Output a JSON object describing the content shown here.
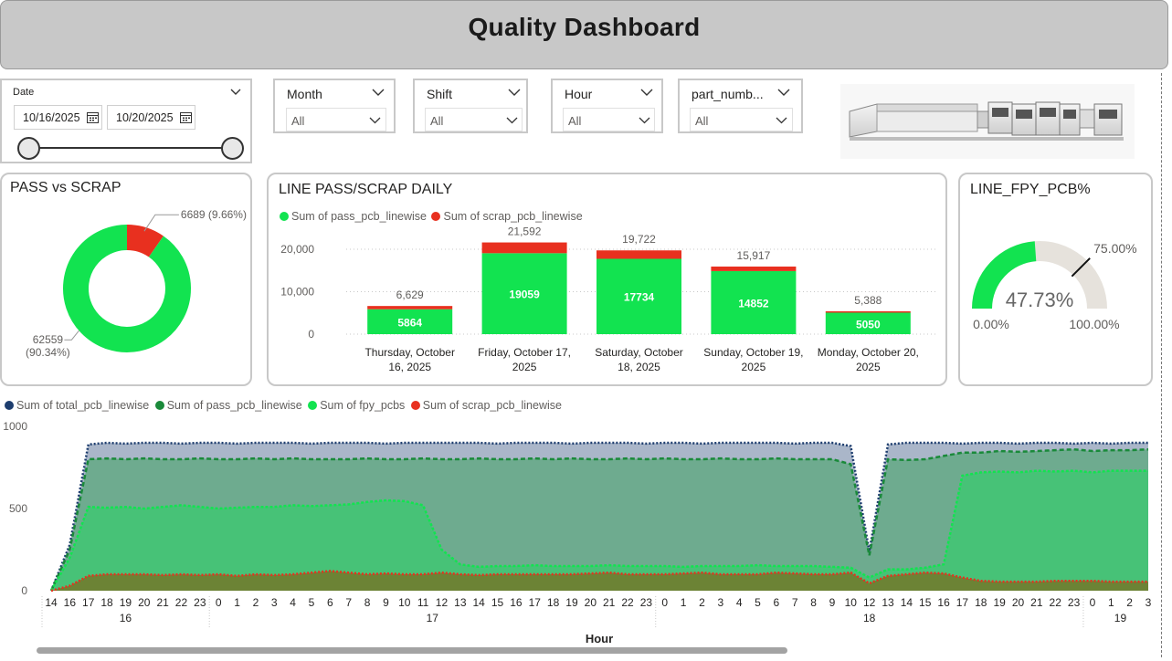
{
  "header": {
    "title": "Quality Dashboard"
  },
  "slicers": {
    "date": {
      "label": "Date",
      "start": "10/16/2025",
      "end": "10/20/2025"
    },
    "month": {
      "label": "Month",
      "value": "All"
    },
    "shift": {
      "label": "Shift",
      "value": "All"
    },
    "hour": {
      "label": "Hour",
      "value": "All"
    },
    "part": {
      "label": "part_numb...",
      "value": "All"
    }
  },
  "colors": {
    "pass": "#12e350",
    "scrap": "#e8301f",
    "total": "#1d3d6e",
    "pass_dark": "#1a8a3a",
    "gauge_track": "#e6e2dc"
  },
  "icons": {
    "calendar": "calendar-icon",
    "chevron": "chevron-down-icon"
  },
  "chart_data": [
    {
      "type": "pie",
      "title": "PASS vs SCRAP",
      "slices": [
        {
          "name": "pass",
          "value": 62559,
          "label_value": "62559",
          "label_pct": "(90.34%)"
        },
        {
          "name": "scrap",
          "value": 6689,
          "label": "6689 (9.66%)"
        }
      ]
    },
    {
      "type": "bar",
      "title": "LINE PASS/SCRAP DAILY",
      "legend": [
        "Sum of pass_pcb_linewise",
        "Sum of scrap_pcb_linewise"
      ],
      "categories": [
        [
          "Thursday, October",
          "16, 2025"
        ],
        [
          "Friday, October 17,",
          "2025"
        ],
        [
          "Saturday, October",
          "18, 2025"
        ],
        [
          "Sunday, October 19,",
          "2025"
        ],
        [
          "Monday, October 20,",
          "2025"
        ]
      ],
      "series": [
        {
          "name": "Sum of pass_pcb_linewise",
          "values": [
            5864,
            19059,
            17734,
            14852,
            5050
          ]
        },
        {
          "name": "Sum of scrap_pcb_linewise",
          "values": [
            765,
            2533,
            1988,
            1065,
            338
          ]
        }
      ],
      "totals": [
        "6,629",
        "21,592",
        "19,722",
        "15,917",
        "5,388"
      ],
      "pass_labels": [
        "5864",
        "19059",
        "17734",
        "14852",
        "5050"
      ],
      "yticks": [
        {
          "v": 0,
          "label": "0"
        },
        {
          "v": 10000,
          "label": "10,000"
        },
        {
          "v": 20000,
          "label": "20,000"
        }
      ],
      "ylim": [
        0,
        23000
      ]
    },
    {
      "type": "gauge",
      "title": "LINE_FPY_PCB%",
      "value": 47.73,
      "value_label": "47.73%",
      "min_label": "0.00%",
      "max_label": "100.00%",
      "target": 75,
      "target_label": "75.00%"
    },
    {
      "type": "area",
      "legend": [
        "Sum of total_pcb_linewise",
        "Sum of pass_pcb_linewise",
        "Sum of fpy_pcbs",
        "Sum of scrap_pcb_linewise"
      ],
      "xlabel": "Hour",
      "hours": [
        "14",
        "16",
        "17",
        "18",
        "19",
        "20",
        "21",
        "22",
        "23",
        "0",
        "1",
        "2",
        "3",
        "4",
        "5",
        "6",
        "7",
        "8",
        "9",
        "10",
        "11",
        "12",
        "13",
        "14",
        "15",
        "16",
        "17",
        "18",
        "19",
        "20",
        "21",
        "22",
        "23",
        "0",
        "1",
        "2",
        "3",
        "4",
        "5",
        "6",
        "7",
        "8",
        "9",
        "10",
        "12",
        "13",
        "14",
        "15",
        "16",
        "17",
        "18",
        "19",
        "20",
        "21",
        "22",
        "23",
        "0",
        "1",
        "2",
        "3"
      ],
      "day_groups": [
        {
          "label": "16",
          "start": 0,
          "end": 8
        },
        {
          "label": "17",
          "start": 9,
          "end": 32
        },
        {
          "label": "18",
          "start": 33,
          "end": 55
        },
        {
          "label": "19",
          "start": 56,
          "end": 59
        }
      ],
      "series": [
        {
          "name": "Sum of total_pcb_linewise",
          "values": [
            0,
            280,
            890,
            900,
            895,
            900,
            900,
            895,
            900,
            900,
            895,
            900,
            900,
            900,
            895,
            900,
            900,
            900,
            895,
            900,
            900,
            900,
            900,
            900,
            895,
            900,
            900,
            900,
            895,
            900,
            900,
            900,
            895,
            900,
            900,
            895,
            900,
            900,
            900,
            900,
            895,
            900,
            900,
            880,
            240,
            890,
            900,
            900,
            900,
            895,
            900,
            900,
            895,
            900,
            900,
            895,
            900,
            895,
            900,
            900
          ]
        },
        {
          "name": "Sum of pass_pcb_linewise",
          "values": [
            0,
            250,
            800,
            805,
            800,
            805,
            800,
            800,
            805,
            800,
            800,
            805,
            800,
            805,
            800,
            800,
            800,
            805,
            800,
            800,
            805,
            800,
            800,
            805,
            800,
            800,
            805,
            800,
            805,
            800,
            800,
            805,
            800,
            805,
            800,
            800,
            805,
            800,
            800,
            805,
            800,
            800,
            800,
            770,
            215,
            800,
            795,
            800,
            820,
            840,
            840,
            850,
            845,
            850,
            855,
            860,
            850,
            855,
            855,
            860
          ]
        },
        {
          "name": "Sum of fpy_pcbs",
          "values": [
            0,
            200,
            510,
            505,
            510,
            500,
            510,
            520,
            510,
            500,
            505,
            510,
            510,
            520,
            515,
            520,
            525,
            540,
            550,
            545,
            520,
            250,
            160,
            145,
            150,
            150,
            155,
            150,
            150,
            150,
            155,
            150,
            150,
            150,
            145,
            150,
            150,
            150,
            155,
            150,
            150,
            150,
            145,
            140,
            80,
            130,
            130,
            140,
            160,
            700,
            720,
            725,
            720,
            730,
            725,
            730,
            720,
            730,
            730,
            730
          ]
        },
        {
          "name": "Sum of scrap_pcb_linewise",
          "values": [
            0,
            30,
            90,
            100,
            100,
            100,
            95,
            100,
            95,
            100,
            90,
            100,
            95,
            100,
            110,
            120,
            110,
            100,
            105,
            100,
            100,
            110,
            100,
            95,
            100,
            100,
            100,
            100,
            100,
            105,
            110,
            100,
            100,
            100,
            105,
            110,
            100,
            100,
            100,
            110,
            105,
            100,
            100,
            110,
            45,
            90,
            100,
            110,
            105,
            80,
            60,
            55,
            55,
            55,
            60,
            60,
            60,
            55,
            55,
            55
          ]
        }
      ],
      "yticks": [
        {
          "v": 0,
          "label": "0"
        },
        {
          "v": 500,
          "label": "500"
        },
        {
          "v": 1000,
          "label": "1000"
        }
      ],
      "ylim": [
        0,
        1000
      ]
    }
  ]
}
